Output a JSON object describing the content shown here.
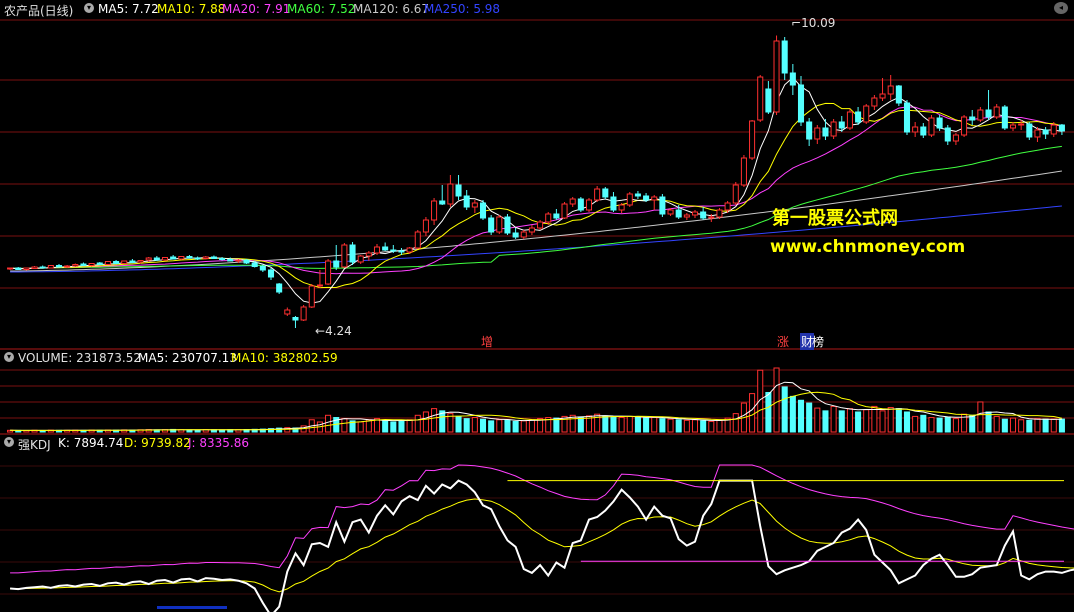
{
  "colors": {
    "background": "#000000",
    "grid_red": "#7a1010",
    "up": "#ff3030",
    "down": "#54ffff",
    "ma5": "#ffffff",
    "ma10": "#ffff00",
    "ma20": "#ff40ff",
    "ma60": "#40ff40",
    "ma120": "#c8c8c8",
    "ma250": "#3344ff",
    "kdj_k": "#ffffff",
    "kdj_d": "#ffff00",
    "kdj_j": "#ff40ff",
    "watermark": "#ffff00"
  },
  "price_header": {
    "title": "农产品(日线)",
    "ma5": "MA5: 7.72",
    "ma10": "MA10: 7.88",
    "ma20": "MA20: 7.91",
    "ma60": "MA60: 7.52",
    "ma120": "MA120: 6.67",
    "ma250": "MA250: 5.98"
  },
  "volume_header": {
    "volume": "VOLUME: 231873.52",
    "ma5": "MA5: 230707.13",
    "ma10": "MA10: 382802.59"
  },
  "kdj_header": {
    "name": "强KDJ",
    "k": "K: 7894.74",
    "d": "D: 9739.82",
    "j": "J: 8335.86"
  },
  "annotations": {
    "high": "10.09",
    "low": "4.24",
    "tag1": "增",
    "tag2": "涨",
    "tag3": "财",
    "tag4": "榜"
  },
  "watermark": {
    "line1": "第一股票公式网",
    "line2": "www.chnmoney.com"
  },
  "chart_data": {
    "type": "candlestick",
    "price_range": [
      3.9,
      10.4
    ],
    "candles": [
      [
        5.42,
        5.45,
        5.4,
        5.44
      ],
      [
        5.44,
        5.46,
        5.4,
        5.41
      ],
      [
        5.41,
        5.45,
        5.39,
        5.44
      ],
      [
        5.43,
        5.48,
        5.42,
        5.46
      ],
      [
        5.46,
        5.49,
        5.43,
        5.44
      ],
      [
        5.44,
        5.5,
        5.43,
        5.49
      ],
      [
        5.49,
        5.52,
        5.45,
        5.46
      ],
      [
        5.46,
        5.5,
        5.44,
        5.48
      ],
      [
        5.48,
        5.53,
        5.46,
        5.51
      ],
      [
        5.52,
        5.55,
        5.48,
        5.49
      ],
      [
        5.49,
        5.54,
        5.47,
        5.53
      ],
      [
        5.54,
        5.56,
        5.5,
        5.51
      ],
      [
        5.51,
        5.58,
        5.5,
        5.57
      ],
      [
        5.57,
        5.6,
        5.52,
        5.53
      ],
      [
        5.53,
        5.59,
        5.52,
        5.58
      ],
      [
        5.58,
        5.62,
        5.54,
        5.55
      ],
      [
        5.56,
        5.6,
        5.53,
        5.59
      ],
      [
        5.6,
        5.66,
        5.57,
        5.64
      ],
      [
        5.64,
        5.68,
        5.58,
        5.6
      ],
      [
        5.6,
        5.66,
        5.58,
        5.65
      ],
      [
        5.66,
        5.7,
        5.61,
        5.62
      ],
      [
        5.62,
        5.68,
        5.6,
        5.67
      ],
      [
        5.67,
        5.7,
        5.63,
        5.64
      ],
      [
        5.64,
        5.67,
        5.6,
        5.63
      ],
      [
        5.63,
        5.68,
        5.61,
        5.66
      ],
      [
        5.66,
        5.69,
        5.62,
        5.63
      ],
      [
        5.63,
        5.66,
        5.59,
        5.61
      ],
      [
        5.61,
        5.65,
        5.57,
        5.58
      ],
      [
        5.58,
        5.62,
        5.54,
        5.6
      ],
      [
        5.6,
        5.62,
        5.52,
        5.54
      ],
      [
        5.54,
        5.58,
        5.45,
        5.47
      ],
      [
        5.47,
        5.5,
        5.36,
        5.4
      ],
      [
        5.4,
        5.44,
        5.2,
        5.26
      ],
      [
        5.12,
        5.14,
        4.92,
        4.96
      ],
      [
        4.52,
        4.65,
        4.48,
        4.6
      ],
      [
        4.45,
        4.48,
        4.24,
        4.4
      ],
      [
        4.4,
        4.7,
        4.38,
        4.66
      ],
      [
        4.66,
        5.12,
        4.64,
        5.08
      ],
      [
        5.08,
        5.4,
        5.04,
        5.1
      ],
      [
        5.12,
        5.62,
        5.1,
        5.58
      ],
      [
        5.58,
        5.9,
        5.4,
        5.46
      ],
      [
        5.46,
        5.94,
        5.44,
        5.9
      ],
      [
        5.9,
        5.96,
        5.5,
        5.56
      ],
      [
        5.56,
        5.7,
        5.52,
        5.68
      ],
      [
        5.68,
        5.78,
        5.58,
        5.74
      ],
      [
        5.74,
        5.92,
        5.7,
        5.86
      ],
      [
        5.86,
        5.95,
        5.78,
        5.8
      ],
      [
        5.8,
        5.9,
        5.74,
        5.78
      ],
      [
        5.78,
        5.84,
        5.7,
        5.76
      ],
      [
        5.76,
        5.86,
        5.72,
        5.84
      ],
      [
        5.84,
        6.2,
        5.82,
        6.16
      ],
      [
        6.16,
        6.46,
        6.08,
        6.4
      ],
      [
        6.4,
        6.84,
        6.3,
        6.78
      ],
      [
        6.78,
        7.1,
        6.7,
        6.72
      ],
      [
        6.72,
        7.3,
        6.66,
        7.12
      ],
      [
        7.1,
        7.3,
        6.8,
        6.88
      ],
      [
        6.88,
        7.0,
        6.6,
        6.66
      ],
      [
        6.66,
        6.8,
        6.54,
        6.74
      ],
      [
        6.74,
        6.8,
        6.4,
        6.44
      ],
      [
        6.44,
        6.5,
        6.1,
        6.16
      ],
      [
        6.16,
        6.5,
        6.12,
        6.46
      ],
      [
        6.46,
        6.52,
        6.1,
        6.14
      ],
      [
        6.14,
        6.24,
        6.02,
        6.06
      ],
      [
        6.06,
        6.2,
        6.02,
        6.16
      ],
      [
        6.16,
        6.3,
        6.1,
        6.24
      ],
      [
        6.24,
        6.4,
        6.2,
        6.36
      ],
      [
        6.36,
        6.56,
        6.3,
        6.52
      ],
      [
        6.52,
        6.62,
        6.4,
        6.44
      ],
      [
        6.44,
        6.76,
        6.42,
        6.72
      ],
      [
        6.72,
        6.86,
        6.66,
        6.82
      ],
      [
        6.82,
        6.86,
        6.56,
        6.6
      ],
      [
        6.6,
        6.84,
        6.56,
        6.8
      ],
      [
        6.8,
        7.08,
        6.76,
        7.02
      ],
      [
        7.02,
        7.06,
        6.82,
        6.86
      ],
      [
        6.86,
        6.96,
        6.56,
        6.6
      ],
      [
        6.6,
        6.74,
        6.54,
        6.7
      ],
      [
        6.7,
        6.96,
        6.66,
        6.92
      ],
      [
        6.92,
        6.98,
        6.82,
        6.88
      ],
      [
        6.88,
        6.94,
        6.76,
        6.8
      ],
      [
        6.8,
        6.9,
        6.6,
        6.86
      ],
      [
        6.86,
        6.92,
        6.46,
        6.52
      ],
      [
        6.52,
        6.64,
        6.48,
        6.6
      ],
      [
        6.6,
        6.7,
        6.42,
        6.46
      ],
      [
        6.46,
        6.54,
        6.4,
        6.5
      ],
      [
        6.5,
        6.6,
        6.44,
        6.56
      ],
      [
        6.56,
        6.66,
        6.4,
        6.44
      ],
      [
        6.44,
        6.52,
        6.36,
        6.46
      ],
      [
        6.46,
        6.64,
        6.42,
        6.6
      ],
      [
        6.6,
        6.78,
        6.54,
        6.74
      ],
      [
        6.74,
        7.16,
        6.7,
        7.1
      ],
      [
        7.1,
        7.7,
        7.06,
        7.64
      ],
      [
        7.64,
        8.4,
        7.6,
        8.38
      ],
      [
        8.4,
        9.3,
        8.36,
        9.26
      ],
      [
        9.02,
        9.18,
        8.52,
        8.56
      ],
      [
        8.56,
        10.09,
        8.5,
        9.98
      ],
      [
        9.98,
        10.06,
        9.2,
        9.34
      ],
      [
        9.34,
        9.52,
        8.9,
        9.1
      ],
      [
        9.1,
        9.28,
        8.28,
        8.36
      ],
      [
        8.36,
        8.44,
        7.88,
        8.02
      ],
      [
        8.02,
        8.3,
        7.92,
        8.24
      ],
      [
        8.24,
        8.42,
        8.0,
        8.08
      ],
      [
        8.08,
        8.42,
        8.02,
        8.36
      ],
      [
        8.36,
        8.48,
        8.16,
        8.24
      ],
      [
        8.24,
        8.62,
        8.2,
        8.56
      ],
      [
        8.56,
        8.66,
        8.3,
        8.36
      ],
      [
        8.36,
        8.72,
        8.32,
        8.68
      ],
      [
        8.68,
        8.9,
        8.6,
        8.84
      ],
      [
        8.84,
        9.24,
        8.78,
        8.92
      ],
      [
        8.92,
        9.3,
        8.8,
        9.08
      ],
      [
        9.08,
        9.1,
        8.68,
        8.74
      ],
      [
        8.74,
        8.8,
        8.1,
        8.16
      ],
      [
        8.16,
        8.36,
        8.06,
        8.26
      ],
      [
        8.26,
        8.34,
        8.04,
        8.1
      ],
      [
        8.1,
        8.5,
        8.06,
        8.44
      ],
      [
        8.44,
        8.5,
        8.18,
        8.24
      ],
      [
        8.24,
        8.3,
        7.9,
        7.98
      ],
      [
        7.98,
        8.14,
        7.9,
        8.1
      ],
      [
        8.1,
        8.5,
        8.06,
        8.46
      ],
      [
        8.46,
        8.6,
        8.3,
        8.4
      ],
      [
        8.4,
        8.66,
        8.36,
        8.6
      ],
      [
        8.6,
        9.0,
        8.4,
        8.46
      ],
      [
        8.46,
        8.72,
        8.42,
        8.66
      ],
      [
        8.66,
        8.7,
        8.2,
        8.24
      ],
      [
        8.24,
        8.36,
        8.18,
        8.3
      ],
      [
        8.3,
        8.4,
        8.2,
        8.32
      ],
      [
        8.32,
        8.36,
        8.0,
        8.06
      ],
      [
        8.06,
        8.26,
        7.96,
        8.2
      ],
      [
        8.2,
        8.26,
        8.02,
        8.12
      ],
      [
        8.12,
        8.36,
        8.06,
        8.3
      ],
      [
        8.3,
        8.32,
        8.1,
        8.18
      ]
    ],
    "volume_range": [
      0,
      1150000
    ],
    "volume": [
      30000,
      28000,
      26000,
      31000,
      27000,
      33000,
      29000,
      30000,
      32000,
      28000,
      34000,
      30000,
      36000,
      32000,
      38000,
      34000,
      40000,
      44000,
      38000,
      42000,
      46000,
      40000,
      38000,
      36000,
      42000,
      40000,
      38000,
      42000,
      40000,
      44000,
      48000,
      52000,
      60000,
      70000,
      78000,
      72000,
      110000,
      220000,
      180000,
      300000,
      260000,
      240000,
      200000,
      180000,
      220000,
      240000,
      200000,
      180000,
      190000,
      220000,
      300000,
      360000,
      420000,
      380000,
      330000,
      280000,
      240000,
      260000,
      230000,
      200000,
      220000,
      210000,
      190000,
      200000,
      220000,
      240000,
      260000,
      250000,
      280000,
      300000,
      270000,
      290000,
      320000,
      290000,
      270000,
      260000,
      280000,
      270000,
      250000,
      260000,
      240000,
      230000,
      220000,
      210000,
      220000,
      200000,
      190000,
      210000,
      250000,
      330000,
      520000,
      690000,
      1110000,
      710000,
      1150000,
      810000,
      640000,
      570000,
      520000,
      430000,
      380000,
      460000,
      380000,
      420000,
      360000,
      400000,
      460000,
      380000,
      440000,
      420000,
      360000,
      280000,
      300000,
      260000,
      250000,
      270000,
      240000,
      320000,
      300000,
      540000,
      360000,
      280000,
      230000,
      250000,
      220000,
      210000,
      240000,
      230000,
      230000,
      231873
    ],
    "kdj_range": [
      0,
      12000
    ],
    "kdj": {
      "k": [
        1500,
        1450,
        1550,
        1600,
        1650,
        1550,
        1700,
        1750,
        1650,
        1800,
        1850,
        1700,
        1900,
        1950,
        1800,
        2000,
        2050,
        1850,
        2100,
        2150,
        1950,
        2200,
        2250,
        2050,
        2300,
        2250,
        2150,
        2200,
        2100,
        1900,
        1500,
        400,
        -600,
        100,
        2800,
        4200,
        3300,
        4900,
        5000,
        4700,
        6600,
        5100,
        6600,
        6800,
        5800,
        7100,
        7900,
        7200,
        8200,
        8600,
        8300,
        9400,
        8800,
        9500,
        9200,
        9800,
        9500,
        8900,
        7900,
        7600,
        6300,
        5200,
        4700,
        3000,
        2700,
        3300,
        2500,
        3500,
        3100,
        5000,
        5200,
        6800,
        7000,
        7500,
        8200,
        9100,
        8500,
        7800,
        6800,
        7800,
        7100,
        6900,
        5300,
        4800,
        5100,
        7100,
        8000,
        9800,
        9800,
        9800,
        9800,
        9800,
        6300,
        3200,
        2600,
        2900,
        3100,
        3300,
        3600,
        4400,
        4700,
        5000,
        5800,
        6100,
        6800,
        6000,
        4100,
        3500,
        2900,
        1900,
        2200,
        2500,
        3300,
        3800,
        4100,
        3300,
        2400,
        2400,
        2600,
        3100,
        3200,
        3300,
        4800,
        5900,
        2500,
        2200,
        2600,
        2800,
        2800,
        2700,
        2900,
        3000
      ]
    }
  }
}
